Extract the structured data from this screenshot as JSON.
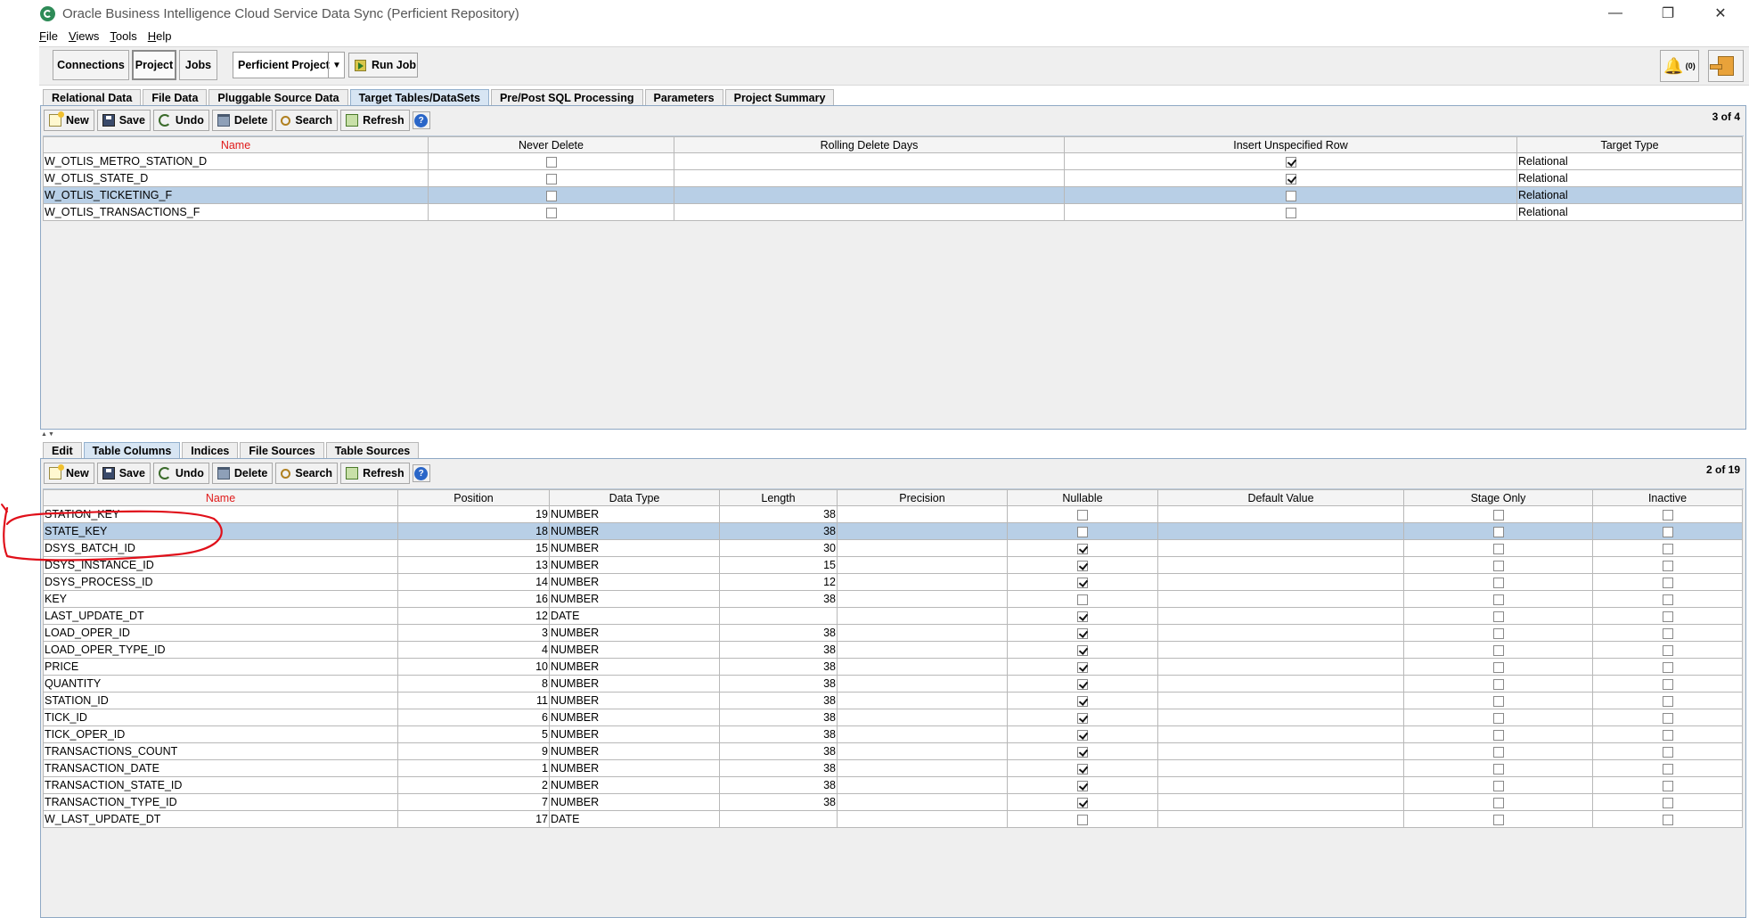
{
  "window": {
    "title": "Oracle Business Intelligence Cloud Service Data Sync (Perficient Repository)",
    "minimize": "—",
    "maximize": "❐",
    "close": "✕"
  },
  "menu": [
    "File",
    "Views",
    "Tools",
    "Help"
  ],
  "toolbar": {
    "connections": "Connections",
    "project": "Project",
    "jobs": "Jobs",
    "project_select": "Perficient Project",
    "run_job": "Run Job",
    "alerts_count": "(0)"
  },
  "top_tabs": [
    "Relational Data",
    "File Data",
    "Pluggable Source Data",
    "Target Tables/DataSets",
    "Pre/Post SQL Processing",
    "Parameters",
    "Project Summary"
  ],
  "top_tabs_active": 3,
  "top_panel": {
    "buttons": {
      "new": "New",
      "save": "Save",
      "undo": "Undo",
      "delete": "Delete",
      "search": "Search",
      "refresh": "Refresh",
      "help": "?"
    },
    "count": "3 of 4",
    "columns": [
      "Name",
      "Never Delete",
      "Rolling Delete Days",
      "Insert Unspecified Row",
      "Target Type"
    ],
    "rows": [
      {
        "name": "W_OTLIS_METRO_STATION_D",
        "never_delete": false,
        "rolling_delete_days": "",
        "insert_unspecified_row": true,
        "target_type": "Relational"
      },
      {
        "name": "W_OTLIS_STATE_D",
        "never_delete": false,
        "rolling_delete_days": "",
        "insert_unspecified_row": true,
        "target_type": "Relational"
      },
      {
        "name": "W_OTLIS_TICKETING_F",
        "never_delete": false,
        "rolling_delete_days": "",
        "insert_unspecified_row": false,
        "target_type": "Relational",
        "selected": true
      },
      {
        "name": "W_OTLIS_TRANSACTIONS_F",
        "never_delete": false,
        "rolling_delete_days": "",
        "insert_unspecified_row": false,
        "target_type": "Relational"
      }
    ]
  },
  "bottom_tabs": [
    "Edit",
    "Table Columns",
    "Indices",
    "File Sources",
    "Table Sources"
  ],
  "bottom_tabs_active": 1,
  "bottom_panel": {
    "buttons": {
      "new": "New",
      "save": "Save",
      "undo": "Undo",
      "delete": "Delete",
      "search": "Search",
      "refresh": "Refresh",
      "help": "?"
    },
    "count": "2 of 19",
    "columns": [
      "Name",
      "Position",
      "Data Type",
      "Length",
      "Precision",
      "Nullable",
      "Default Value",
      "Stage Only",
      "Inactive"
    ],
    "rows": [
      {
        "name": "STATION_KEY",
        "position": "19",
        "data_type": "NUMBER",
        "length": "38",
        "precision": "",
        "nullable": false,
        "default_value": "",
        "stage_only": false,
        "inactive": false
      },
      {
        "name": "STATE_KEY",
        "position": "18",
        "data_type": "NUMBER",
        "length": "38",
        "precision": "",
        "nullable": false,
        "default_value": "",
        "stage_only": false,
        "inactive": false,
        "selected": true
      },
      {
        "name": "DSYS_BATCH_ID",
        "position": "15",
        "data_type": "NUMBER",
        "length": "30",
        "precision": "",
        "nullable": true,
        "default_value": "",
        "stage_only": false,
        "inactive": false
      },
      {
        "name": "DSYS_INSTANCE_ID",
        "position": "13",
        "data_type": "NUMBER",
        "length": "15",
        "precision": "",
        "nullable": true,
        "default_value": "",
        "stage_only": false,
        "inactive": false
      },
      {
        "name": "DSYS_PROCESS_ID",
        "position": "14",
        "data_type": "NUMBER",
        "length": "12",
        "precision": "",
        "nullable": true,
        "default_value": "",
        "stage_only": false,
        "inactive": false
      },
      {
        "name": "KEY",
        "position": "16",
        "data_type": "NUMBER",
        "length": "38",
        "precision": "",
        "nullable": false,
        "default_value": "",
        "stage_only": false,
        "inactive": false
      },
      {
        "name": "LAST_UPDATE_DT",
        "position": "12",
        "data_type": "DATE",
        "length": "",
        "precision": "",
        "nullable": true,
        "default_value": "",
        "stage_only": false,
        "inactive": false
      },
      {
        "name": "LOAD_OPER_ID",
        "position": "3",
        "data_type": "NUMBER",
        "length": "38",
        "precision": "",
        "nullable": true,
        "default_value": "",
        "stage_only": false,
        "inactive": false
      },
      {
        "name": "LOAD_OPER_TYPE_ID",
        "position": "4",
        "data_type": "NUMBER",
        "length": "38",
        "precision": "",
        "nullable": true,
        "default_value": "",
        "stage_only": false,
        "inactive": false
      },
      {
        "name": "PRICE",
        "position": "10",
        "data_type": "NUMBER",
        "length": "38",
        "precision": "",
        "nullable": true,
        "default_value": "",
        "stage_only": false,
        "inactive": false
      },
      {
        "name": "QUANTITY",
        "position": "8",
        "data_type": "NUMBER",
        "length": "38",
        "precision": "",
        "nullable": true,
        "default_value": "",
        "stage_only": false,
        "inactive": false
      },
      {
        "name": "STATION_ID",
        "position": "11",
        "data_type": "NUMBER",
        "length": "38",
        "precision": "",
        "nullable": true,
        "default_value": "",
        "stage_only": false,
        "inactive": false
      },
      {
        "name": "TICK_ID",
        "position": "6",
        "data_type": "NUMBER",
        "length": "38",
        "precision": "",
        "nullable": true,
        "default_value": "",
        "stage_only": false,
        "inactive": false
      },
      {
        "name": "TICK_OPER_ID",
        "position": "5",
        "data_type": "NUMBER",
        "length": "38",
        "precision": "",
        "nullable": true,
        "default_value": "",
        "stage_only": false,
        "inactive": false
      },
      {
        "name": "TRANSACTIONS_COUNT",
        "position": "9",
        "data_type": "NUMBER",
        "length": "38",
        "precision": "",
        "nullable": true,
        "default_value": "",
        "stage_only": false,
        "inactive": false
      },
      {
        "name": "TRANSACTION_DATE",
        "position": "1",
        "data_type": "NUMBER",
        "length": "38",
        "precision": "",
        "nullable": true,
        "default_value": "",
        "stage_only": false,
        "inactive": false
      },
      {
        "name": "TRANSACTION_STATE_ID",
        "position": "2",
        "data_type": "NUMBER",
        "length": "38",
        "precision": "",
        "nullable": true,
        "default_value": "",
        "stage_only": false,
        "inactive": false
      },
      {
        "name": "TRANSACTION_TYPE_ID",
        "position": "7",
        "data_type": "NUMBER",
        "length": "38",
        "precision": "",
        "nullable": true,
        "default_value": "",
        "stage_only": false,
        "inactive": false
      },
      {
        "name": "W_LAST_UPDATE_DT",
        "position": "17",
        "data_type": "DATE",
        "length": "",
        "precision": "",
        "nullable": false,
        "default_value": "",
        "stage_only": false,
        "inactive": false
      }
    ]
  },
  "colors": {
    "selected_row": "#b8cfe6",
    "sorted_header": "#e01b1b",
    "annotation": "#e0101a",
    "active_tab": "#d7e5f3"
  }
}
